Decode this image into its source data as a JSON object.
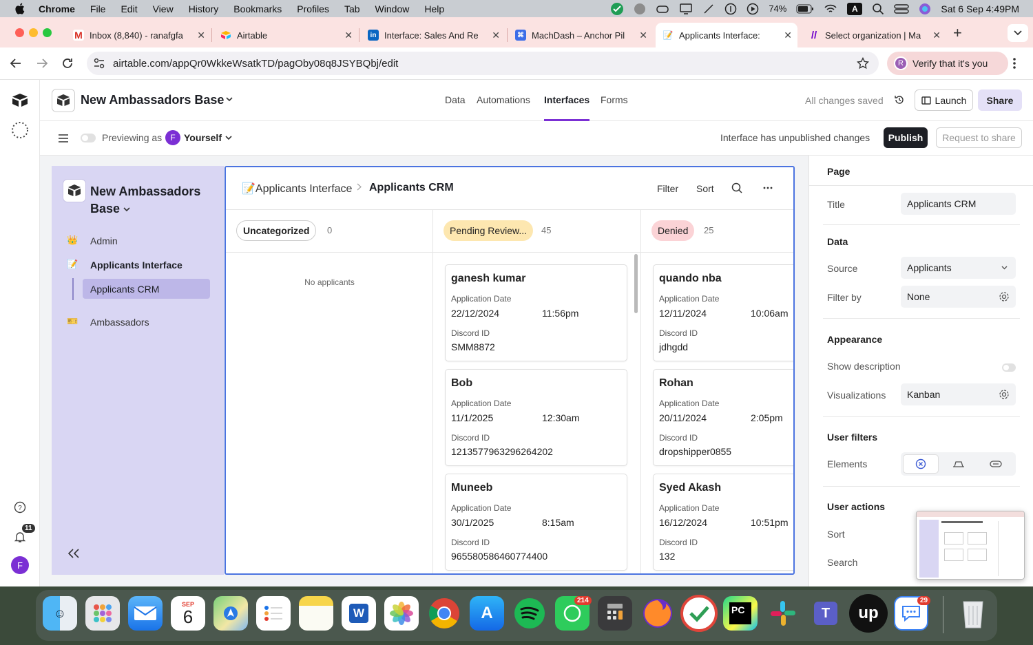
{
  "menubar": {
    "app": "Chrome",
    "items": [
      "File",
      "Edit",
      "View",
      "History",
      "Bookmarks",
      "Profiles",
      "Tab",
      "Window",
      "Help"
    ],
    "battery": "74%",
    "datetime": "Sat 6 Sep  4:49PM"
  },
  "tabs": [
    {
      "label": "Inbox (8,840) - ranafgfa",
      "icon": "gmail-icon",
      "color": "#ffffff"
    },
    {
      "label": "Airtable",
      "icon": "airtable-icon",
      "color": "#ffffff"
    },
    {
      "label": "Interface: Sales And Re",
      "icon": "linkedin-icon",
      "color": "#0a66c2"
    },
    {
      "label": "MachDash – Anchor Pil",
      "icon": "machdash-icon",
      "color": "#3d6ee8"
    },
    {
      "label": "Applicants Interface:",
      "icon": "memo-icon",
      "color": "#ffffff"
    },
    {
      "label": "Select organization | Ma",
      "icon": "make-icon",
      "color": "#6d00cc"
    }
  ],
  "url": "airtable.com/appQr0WkkeWsatkTD/pagOby08q8JSYBQbj/edit",
  "verify_label": "Verify that it's you",
  "verify_avatar": "R",
  "topbar": {
    "base_name": "New Ambassadors Base",
    "nav": [
      "Data",
      "Automations",
      "Interfaces",
      "Forms"
    ],
    "status": "All changes saved",
    "launch": "Launch",
    "share": "Share"
  },
  "subbar": {
    "previewing": "Previewing as",
    "user_initial": "F",
    "user": "Yourself",
    "unpublished": "Interface has unpublished changes",
    "publish": "Publish",
    "request": "Request to share"
  },
  "leftrail": {
    "notif_count": "11",
    "avatar": "F"
  },
  "interface_sidebar": {
    "title_line1": "New Ambassadors",
    "title_line2": "Base",
    "items": [
      {
        "label": "Admin",
        "icon": "crown-emoji-icon"
      },
      {
        "label": "Applicants Interface",
        "icon": "memo-emoji-icon"
      },
      {
        "label": "Applicants CRM",
        "icon": ""
      },
      {
        "label": "Ambassadors",
        "icon": "ticket-emoji-icon"
      }
    ]
  },
  "board": {
    "crumb_parent": "📝Applicants Interface",
    "crumb_current": "Applicants CRM",
    "filter": "Filter",
    "sort": "Sort",
    "columns": [
      {
        "name": "Uncategorized",
        "count": "0",
        "empty": "No applicants"
      },
      {
        "name": "Pending Review...",
        "count": "45"
      },
      {
        "name": "Denied",
        "count": "25"
      }
    ],
    "date_label": "Application Date",
    "discord_label": "Discord ID",
    "pending_cards": [
      {
        "name": "ganesh kumar",
        "date": "22/12/2024",
        "time": "11:56pm",
        "discord": "SMM8872"
      },
      {
        "name": "Bob",
        "date": "11/1/2025",
        "time": "12:30am",
        "discord": "1213577963296264202"
      },
      {
        "name": "Muneeb",
        "date": "30/1/2025",
        "time": "8:15am",
        "discord": "965580586460774400"
      }
    ],
    "denied_cards": [
      {
        "name": "quando nba",
        "date": "12/11/2024",
        "time": "10:06am",
        "discord": "jdhgdd"
      },
      {
        "name": "Rohan",
        "date": "20/11/2024",
        "time": "2:05pm",
        "discord": "dropshipper0855"
      },
      {
        "name": "Syed Akash",
        "date": "16/12/2024",
        "time": "10:51pm",
        "discord": "132"
      }
    ]
  },
  "rightpanel": {
    "page": "Page",
    "title_label": "Title",
    "title_value": "Applicants CRM",
    "data": "Data",
    "source_label": "Source",
    "source_value": "Applicants",
    "filter_label": "Filter by",
    "filter_value": "None",
    "appearance": "Appearance",
    "show_desc": "Show description",
    "vis_label": "Visualizations",
    "vis_value": "Kanban",
    "user_filters": "User filters",
    "elements": "Elements",
    "user_actions": "User actions",
    "sort": "Sort",
    "search": "Search"
  },
  "dock": {
    "calendar_month": "SEP",
    "calendar_day": "6",
    "whatsapp_badge": "214",
    "chat_badge": "29"
  },
  "colors": {
    "accent_blue": "#4b73e0",
    "pending_chip": "#fde7b0",
    "denied_chip": "#fbd3d6",
    "sidebar": "#d9d6f3",
    "share_btn": "#e4e0f7"
  }
}
